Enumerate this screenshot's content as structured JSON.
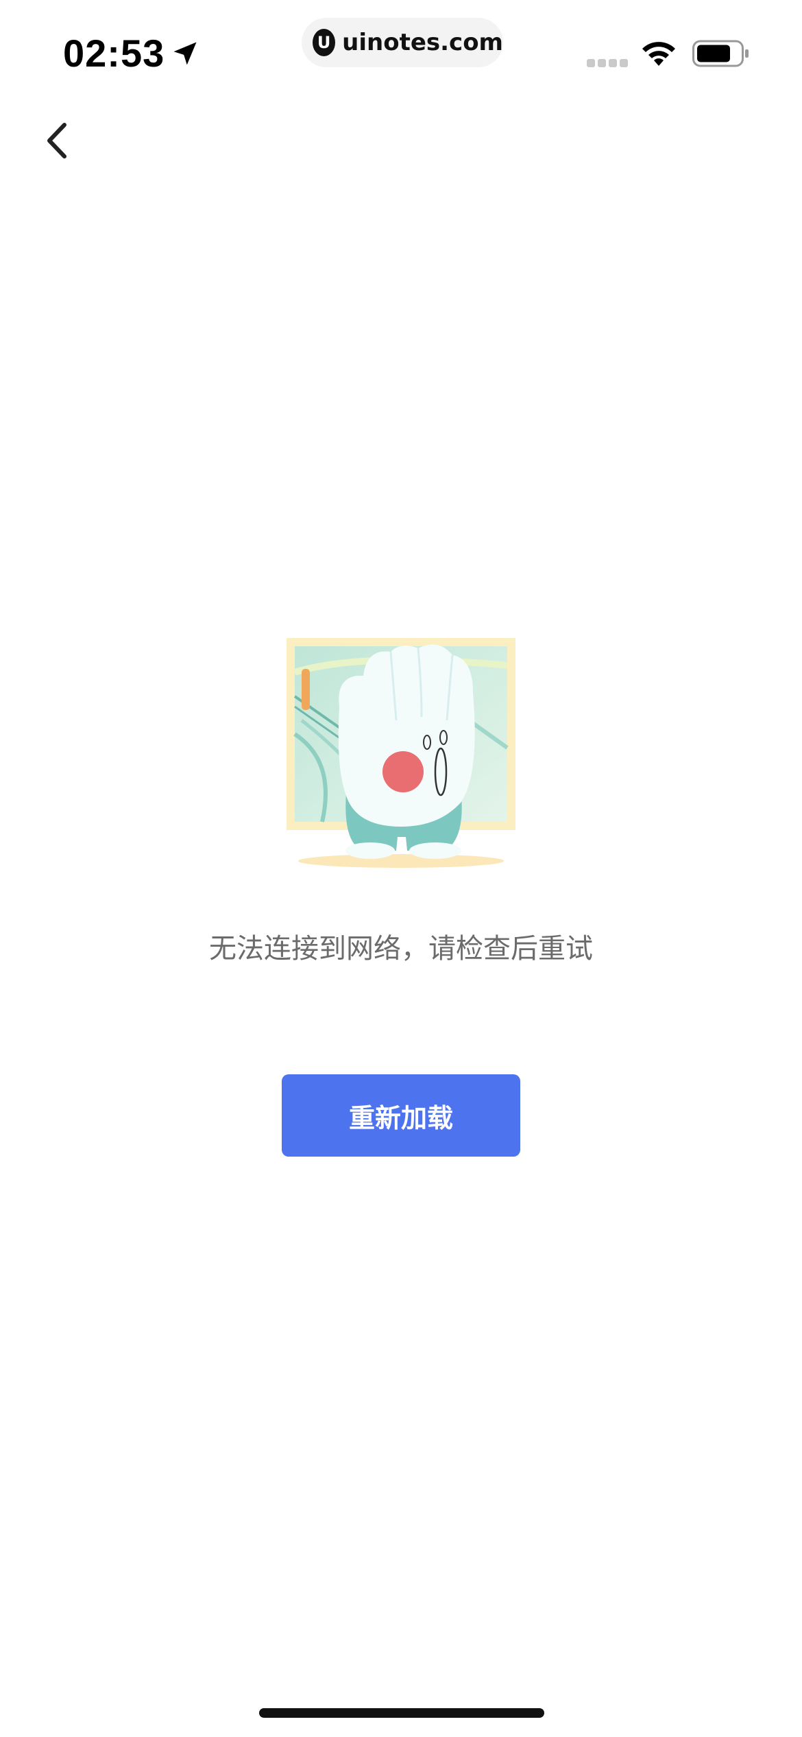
{
  "status_bar": {
    "time": "02:53",
    "url": "uinotes.com",
    "url_logo_letter": "U",
    "location_icon": "location-arrow-icon",
    "signal_icon": "cellular-signal-icon",
    "wifi_icon": "wifi-icon",
    "battery_icon": "battery-icon"
  },
  "nav": {
    "back_icon": "chevron-left-icon"
  },
  "content": {
    "illustration": "glove-character-scream-illustration",
    "error_message": "无法连接到网络，请检查后重试",
    "reload_button_label": "重新加载"
  },
  "colors": {
    "accent": "#4d73ee",
    "message_text": "#6b6b6b",
    "background": "#ffffff"
  }
}
